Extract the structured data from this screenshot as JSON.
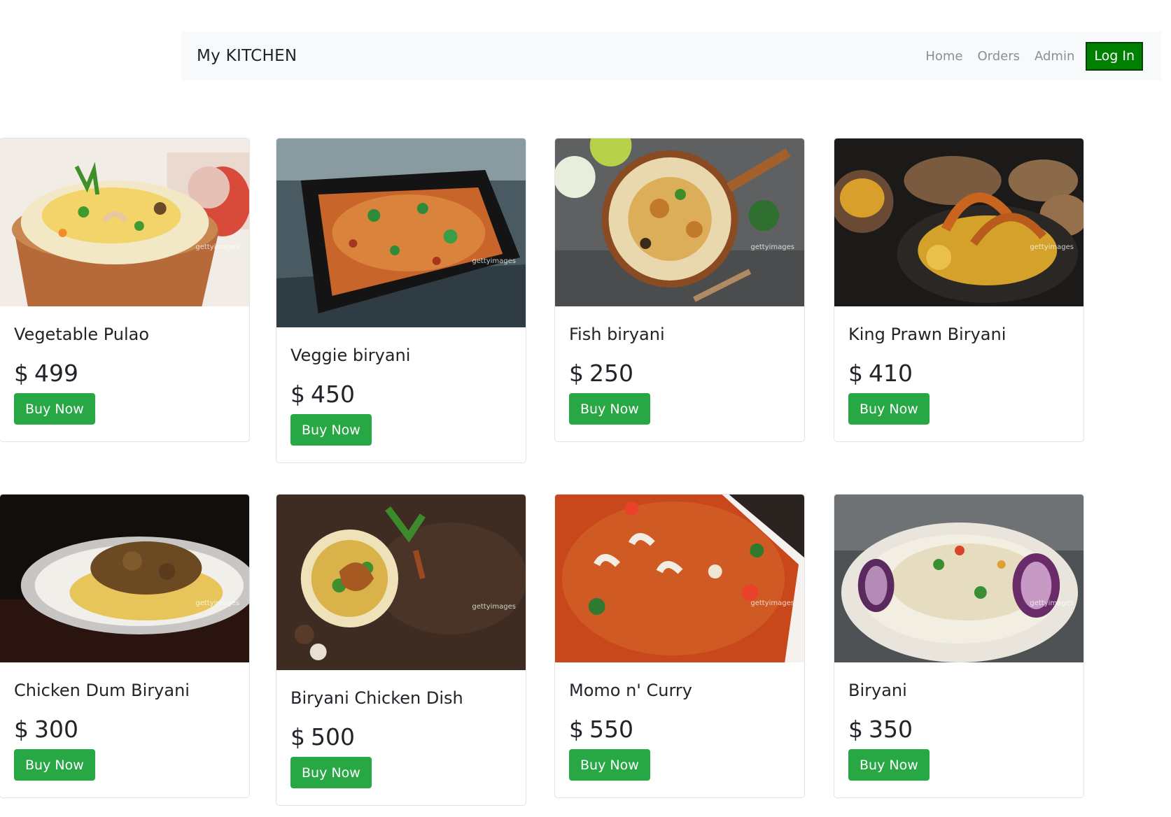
{
  "navbar": {
    "brand": "My KITCHEN",
    "links": [
      "Home",
      "Orders",
      "Admin"
    ],
    "login_label": "Log In",
    "login_color": "#008000"
  },
  "currency_symbol": "$",
  "buy_label": "Buy Now",
  "watermark": "gettyimages",
  "products": [
    {
      "name": "Vegetable Pulao",
      "price": "499"
    },
    {
      "name": "Veggie biryani",
      "price": "450"
    },
    {
      "name": "Fish biryani",
      "price": "250"
    },
    {
      "name": "King Prawn Biryani",
      "price": "410"
    },
    {
      "name": "Chicken Dum Biryani",
      "price": "300"
    },
    {
      "name": "Biryani Chicken Dish",
      "price": "500"
    },
    {
      "name": "Momo n' Curry",
      "price": "550"
    },
    {
      "name": "Biryani",
      "price": "350"
    }
  ],
  "colors": {
    "buy_button": "#28a745",
    "navbar_bg": "#f8f9fa"
  }
}
